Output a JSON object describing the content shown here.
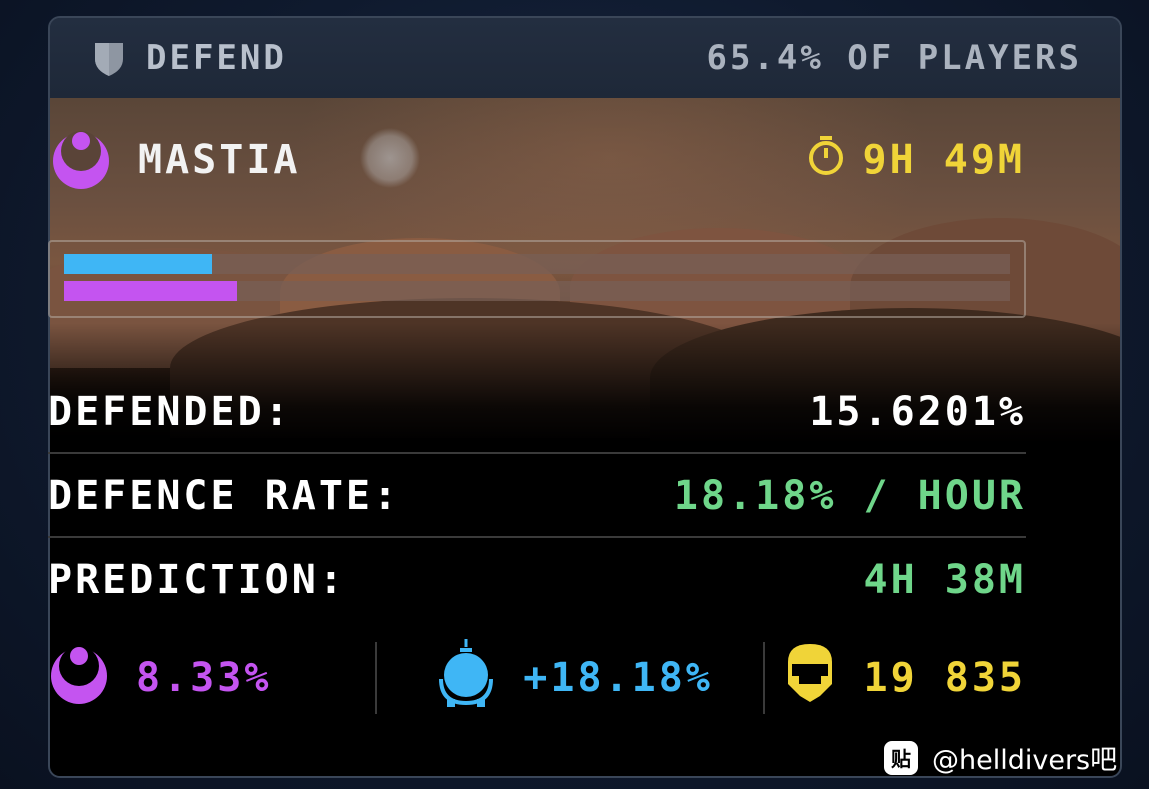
{
  "header": {
    "title": "DEFEND",
    "players": "65.4% OF PLAYERS",
    "icon": "shield-icon"
  },
  "planet": {
    "name": "MASTIA",
    "faction_icon": "illuminate-icon",
    "time_left": "9H 49M",
    "timer_icon": "stopwatch-icon"
  },
  "progress": {
    "defender_fraction": 0.1562,
    "attacker_fraction": 0.1833,
    "defender_color": "#3fb6f5",
    "attacker_color": "#c454f0"
  },
  "stats": {
    "defended_label": "DEFENDED:",
    "defended_value": "15.6201%",
    "rate_label": "DEFENCE RATE:",
    "rate_value": "18.18% / HOUR",
    "prediction_label": "PREDICTION:",
    "prediction_value": "4H 38M"
  },
  "footer": {
    "enemy_value": "8.33%",
    "enemy_icon": "illuminate-icon",
    "super_earth_value": "+18.18%",
    "super_earth_icon": "super-earth-icon",
    "players_value": "19 835",
    "players_icon": "helldiver-helmet-icon"
  },
  "colors": {
    "accent_yellow": "#f0d438",
    "green": "#6fd68a",
    "purple": "#c454f0",
    "blue": "#3fb6f5"
  },
  "watermark": {
    "icon_text": "贴",
    "text": "@helldivers吧"
  }
}
